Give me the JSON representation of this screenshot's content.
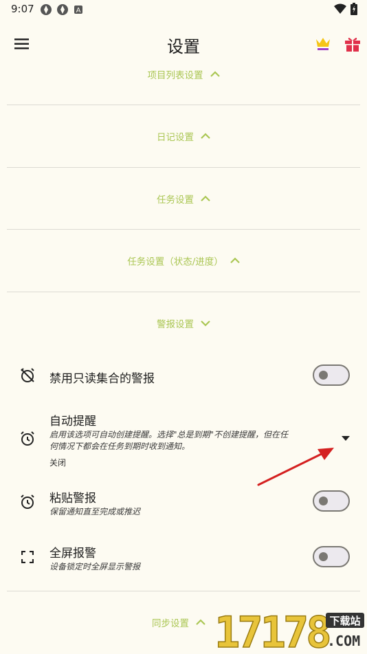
{
  "status_bar": {
    "time": "9:07",
    "left_icons": [
      "app-icon",
      "app-icon",
      "a-icon"
    ],
    "right_icons": [
      "wifi-icon",
      "battery-icon"
    ]
  },
  "app_bar": {
    "title": "设置",
    "menu_icon": "menu-icon",
    "actions": [
      "crown-icon",
      "gift-icon"
    ]
  },
  "colors": {
    "accent": "#aac653",
    "background": "#fdfbf2",
    "annotation_arrow": "#d42020"
  },
  "sections": [
    {
      "label": "项目列表设置",
      "chevron": "up"
    },
    {
      "label": "日记设置",
      "chevron": "up"
    },
    {
      "label": "任务设置",
      "chevron": "up"
    },
    {
      "label": "任务设置（状态/进度）",
      "chevron": "up"
    },
    {
      "label": "警报设置",
      "chevron": "down"
    },
    {
      "label": "同步设置",
      "chevron": "up"
    }
  ],
  "alarm_settings": {
    "disable_readonly": {
      "title": "禁用只读集合的警报",
      "toggle_on": false
    },
    "auto_reminder": {
      "title": "自动提醒",
      "description_line1": "启用该选项可自动创建提醒。选择\"总是到期\"不创建提醒，但在任",
      "description_line2": "何情况下都会在任务到期时收到通知。",
      "value": "关闭"
    },
    "sticky_alarm": {
      "title": "粘贴警报",
      "description": "保留通知直至完成或推迟",
      "toggle_on": false
    },
    "fullscreen_alarm": {
      "title": "全屏报警",
      "description": "设备锁定时全屏显示警报",
      "toggle_on": false
    }
  },
  "watermark": {
    "digits": "17178",
    "badge": "下载站",
    "domain": ".COM"
  }
}
